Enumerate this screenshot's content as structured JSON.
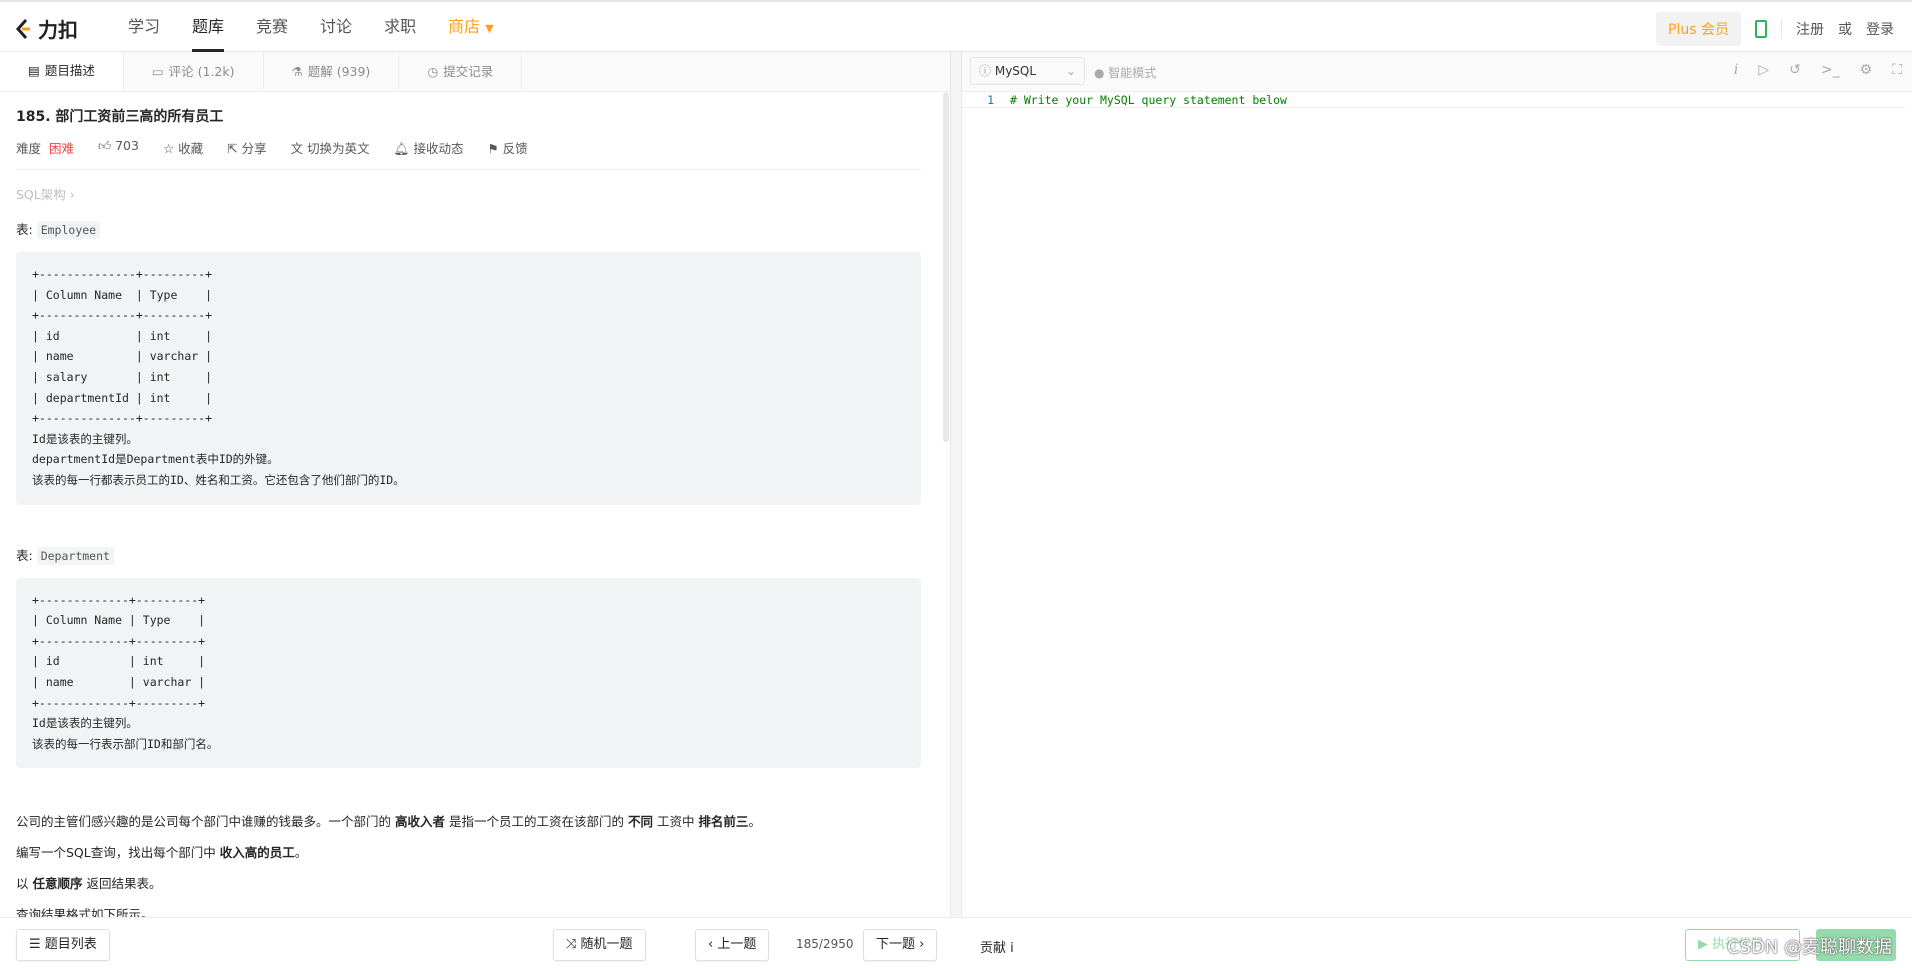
{
  "nav": {
    "logo": "力扣",
    "items": [
      "学习",
      "题库",
      "竞赛",
      "讨论",
      "求职"
    ],
    "shop": "商店",
    "plus": "Plus 会员",
    "register": "注册",
    "or": "或",
    "login": "登录"
  },
  "tabs": [
    "题目描述",
    "评论 (1.2k)",
    "题解 (939)",
    "提交记录"
  ],
  "problem": {
    "title": "185. 部门工资前三高的所有员工",
    "difficulty_label": "难度",
    "difficulty": "困难",
    "likes": "703",
    "actions": [
      "收藏",
      "分享",
      "切换为英文",
      "接收动态",
      "反馈"
    ],
    "tag": "SQL架构 ›",
    "table_label": "表:",
    "table1": "Employee",
    "block1": "+--------------+---------+\n| Column Name  | Type    |\n+--------------+---------+\n| id           | int     |\n| name         | varchar |\n| salary       | int     |\n| departmentId | int     |\n+--------------+---------+\nId是该表的主键列。\ndepartmentId是Department表中ID的外键。\n该表的每一行都表示员工的ID、姓名和工资。它还包含了他们部门的ID。",
    "table2": "Department",
    "block2": "+-------------+---------+\n| Column Name | Type    |\n+-------------+---------+\n| id          | int     |\n| name        | varchar |\n+-------------+---------+\nId是该表的主键列。\n该表的每一行表示部门ID和部门名。",
    "p1": [
      "公司的主管们感兴趣的是公司每个部门中谁赚的钱最多。一个部门的 ",
      "高收入者",
      " 是指一个员工的工资在该部门的 ",
      "不同",
      " 工资中 ",
      "排名前三",
      "。"
    ],
    "p2": [
      "编写一个SQL查询，找出每个部门中 ",
      "收入高的员工",
      "。"
    ],
    "p3": [
      "以 ",
      "任意顺序",
      " 返回结果表。"
    ],
    "p4": "查询结果格式如下所示。"
  },
  "editor": {
    "language": "MySQL",
    "smart_mode": "智能模式",
    "line_no": "1",
    "code": "# Write your MySQL query statement below"
  },
  "bottom": {
    "list": "题目列表",
    "random": "随机一题",
    "prev": "上一题",
    "page": "185/2950",
    "next": "下一题",
    "contribute": "贡献 i",
    "run": "▶ 执行代码",
    "watermark": "CSDN @麦聪聊数据"
  }
}
